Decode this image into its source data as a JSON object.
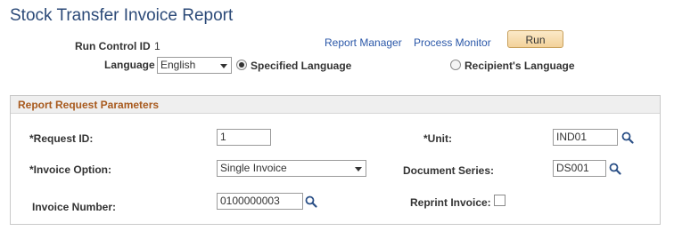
{
  "page": {
    "title": "Stock Transfer Invoice Report"
  },
  "run_control": {
    "label": "Run Control ID",
    "value": "1"
  },
  "links": {
    "report_manager": "Report Manager",
    "process_monitor": "Process Monitor"
  },
  "run_button": "Run",
  "language": {
    "label": "Language",
    "selected": "English",
    "options": {
      "specified": "Specified Language",
      "recipient": "Recipient's Language"
    },
    "selected_option": "specified"
  },
  "panel": {
    "title": "Report Request Parameters",
    "request_id": {
      "label": "*Request ID:",
      "value": "1"
    },
    "unit": {
      "label": "*Unit:",
      "value": "IND01"
    },
    "invoice_option": {
      "label": "*Invoice Option:",
      "selected": "Single Invoice"
    },
    "document_series": {
      "label": "Document Series:",
      "value": "DS001"
    },
    "invoice_number": {
      "label": "Invoice Number:",
      "value": "0100000003"
    },
    "reprint_invoice": {
      "label": "Reprint Invoice:",
      "checked": false
    }
  },
  "colors": {
    "title": "#2c4a78",
    "link": "#2a57a8",
    "panel_title": "#a85a1e",
    "run_button": "#f3d29a"
  },
  "icons": {
    "lookup": "magnifier-icon",
    "dropdown": "chevron-down-icon"
  }
}
